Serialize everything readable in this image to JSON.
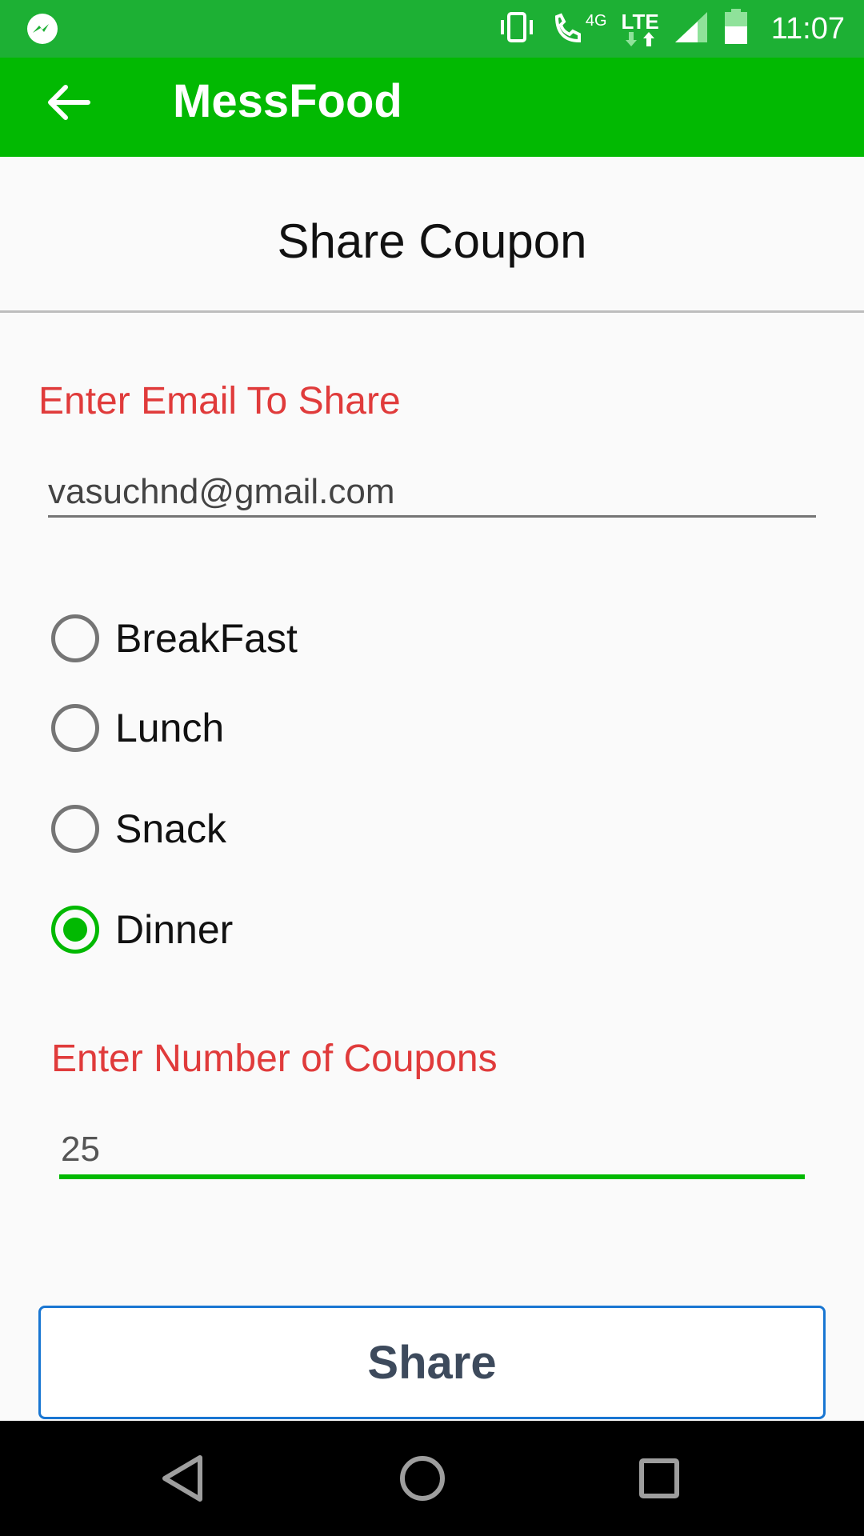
{
  "status_bar": {
    "time": "11:07",
    "network": "LTE",
    "network_sub": "4G",
    "icons": [
      "messenger-icon",
      "vibrate-icon",
      "wifi-calling-icon",
      "signal-icon",
      "battery-icon"
    ]
  },
  "app_bar": {
    "title": "MessFood",
    "back_icon": "arrow-left-icon"
  },
  "page": {
    "title": "Share Coupon"
  },
  "email_section": {
    "label": "Enter Email To Share",
    "value": "vasuchnd@gmail.com"
  },
  "meal_options": [
    {
      "label": "BreakFast",
      "checked": false
    },
    {
      "label": "Lunch",
      "checked": false
    },
    {
      "label": "Snack",
      "checked": false
    },
    {
      "label": "Dinner",
      "checked": true
    }
  ],
  "coupon_section": {
    "label": "Enter Number of Coupons",
    "value": "25"
  },
  "share_button": {
    "label": "Share"
  },
  "colors": {
    "status_bar": "#1db034",
    "app_bar": "#02b902",
    "accent": "#02b902",
    "label_red": "#e03b3b",
    "button_border": "#1976d2"
  }
}
